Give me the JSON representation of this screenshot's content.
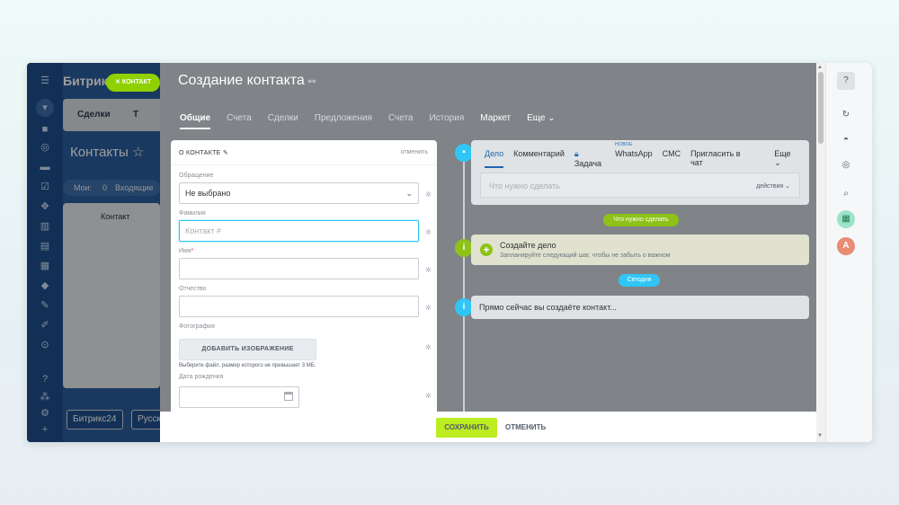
{
  "background_crm": {
    "logo": "Битрикс",
    "tabs": [
      "Сделки",
      "Т"
    ],
    "title": "Контакты",
    "filter_label": "Мои:",
    "filter_count": "0",
    "filter_item": "Входящие",
    "table_header": "Контакт",
    "bottom_logo": "Битрикс24",
    "bottom_lang": "Русск",
    "contact_pill": "КОНТАКТ"
  },
  "slider": {
    "title": "Создание контакта",
    "tabs": [
      "Общие",
      "Счета",
      "Сделки",
      "Предложения",
      "Счета",
      "История",
      "Маркет",
      "Еще"
    ]
  },
  "form": {
    "header_title": "О КОНТАКТЕ",
    "header_cancel": "отменить",
    "salutation_label": "Обращение",
    "salutation_value": "Не выбрано",
    "lastname_label": "Фамилия",
    "lastname_placeholder": "Контакт #",
    "name_label": "Имя",
    "patronymic_label": "Отчество",
    "photo_label": "Фотография",
    "add_image": "ДОБАВИТЬ ИЗОБРАЖЕНИЕ",
    "file_hint": "Выберите файл, размер которого не превышает 3 МБ.",
    "birthday_label": "Дата рождения"
  },
  "activity": {
    "tabs": [
      "Дело",
      "Комментарий",
      "Задача",
      "WhatsApp",
      "СМС",
      "Пригласить в чат",
      "Еще"
    ],
    "new_badge": "НОВОЕ",
    "input_placeholder": "Что нужно сделать",
    "actions_label": "действия"
  },
  "timeline": {
    "todo_pill": "Что нужно сделать",
    "todo_title": "Создайте дело",
    "todo_hint": "Запланируйте следующий шаг, чтобы не забыть о важном",
    "today_pill": "Сегодня",
    "info_text": "Прямо сейчас вы создаёте контакт..."
  },
  "footer": {
    "save": "СОХРАНИТЬ",
    "cancel": "ОТМЕНИТЬ"
  },
  "rightbar": {
    "avatar_letter": "A"
  },
  "colors": {
    "accent_green": "#bbed21",
    "timeline_blue": "#2fc6f6",
    "timeline_green": "#8fc218",
    "left_bar": "#1d4e8c"
  }
}
